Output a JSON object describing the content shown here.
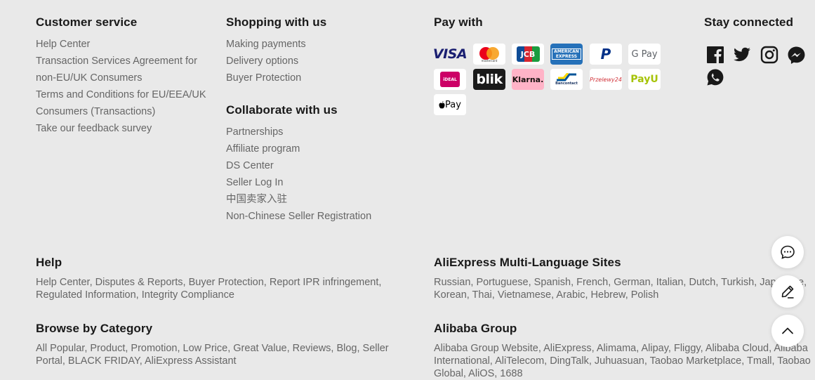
{
  "customer_service": {
    "heading": "Customer service",
    "links": [
      "Help Center",
      "Transaction Services Agreement for",
      "non-EU/UK Consumers",
      "Terms and Conditions for EU/EEA/UK",
      "Consumers (Transactions)",
      "Take our feedback survey"
    ]
  },
  "shopping": {
    "heading": "Shopping with us",
    "links": [
      "Making payments",
      "Delivery options",
      "Buyer Protection"
    ]
  },
  "collaborate": {
    "heading": "Collaborate with us",
    "links": [
      "Partnerships",
      "Affiliate program",
      "DS Center",
      "Seller Log In",
      "中国卖家入驻",
      "Non-Chinese Seller Registration"
    ]
  },
  "pay_with": {
    "heading": "Pay with",
    "methods": {
      "visa": "VISA",
      "mastercard": "mastercard",
      "jcb": "JCB",
      "amex": "AMERICAN EXPRESS",
      "paypal": "P",
      "gpay": "G Pay",
      "ideal": "iDEAL",
      "blik": "blik",
      "klarna": "Klarna.",
      "bancontact": "Bancontact",
      "przelewy": "Przelewy24",
      "payu": "PayU",
      "applepay": " Pay"
    }
  },
  "stay_connected": {
    "heading": "Stay connected",
    "icons": [
      "facebook-icon",
      "twitter-icon",
      "instagram-icon",
      "messenger-icon",
      "whatsapp-icon"
    ]
  },
  "help": {
    "heading": "Help",
    "text": "Help Center, Disputes & Reports, Buyer Protection, Report IPR infringement, Regulated Information, Integrity Compliance"
  },
  "multi_language": {
    "heading": "AliExpress Multi-Language Sites",
    "text": "Russian, Portuguese, Spanish, French, German, Italian, Dutch, Turkish, Japanese, Korean, Thai, Vietnamese, Arabic, Hebrew, Polish"
  },
  "browse_category": {
    "heading": "Browse by Category",
    "text": "All Popular, Product, Promotion, Low Price, Great Value, Reviews, Blog, Seller Portal, BLACK FRIDAY, AliExpress Assistant"
  },
  "alibaba_group": {
    "heading": "Alibaba Group",
    "text": "Alibaba Group Website, AliExpress, Alimama, Alipay, Fliggy, Alibaba Cloud, Alibaba International, AliTelecom, DingTalk, Juhuasuan, Taobao Marketplace, Tmall, Taobao Global, AliOS, 1688"
  },
  "colors": {
    "background": "#e9e9e9",
    "heading": "#191919",
    "link": "#666666"
  }
}
